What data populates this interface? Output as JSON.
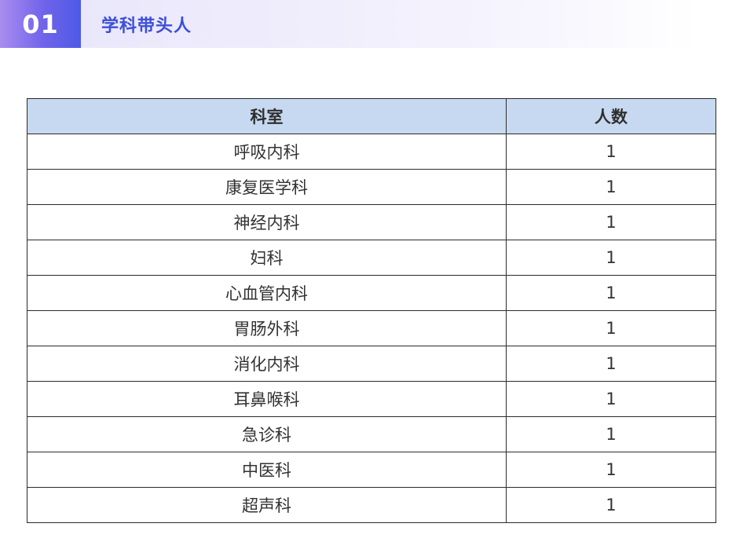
{
  "header": {
    "number": "01",
    "title": "学科带头人"
  },
  "table": {
    "columns": [
      "科室",
      "人数"
    ],
    "rows": [
      {
        "dept": "呼吸内科",
        "count": "1"
      },
      {
        "dept": "康复医学科",
        "count": "1"
      },
      {
        "dept": "神经内科",
        "count": "1"
      },
      {
        "dept": "妇科",
        "count": "1"
      },
      {
        "dept": "心血管内科",
        "count": "1"
      },
      {
        "dept": "胃肠外科",
        "count": "1"
      },
      {
        "dept": "消化内科",
        "count": "1"
      },
      {
        "dept": "耳鼻喉科",
        "count": "1"
      },
      {
        "dept": "急诊科",
        "count": "1"
      },
      {
        "dept": "中医科",
        "count": "1"
      },
      {
        "dept": "超声科",
        "count": "1"
      }
    ]
  },
  "colors": {
    "accent": "#3b4fd8",
    "number_box_gradient_start": "#a98cf0",
    "number_box_gradient_end": "#4d5ae6",
    "table_header_bg": "#c6d9f0"
  }
}
